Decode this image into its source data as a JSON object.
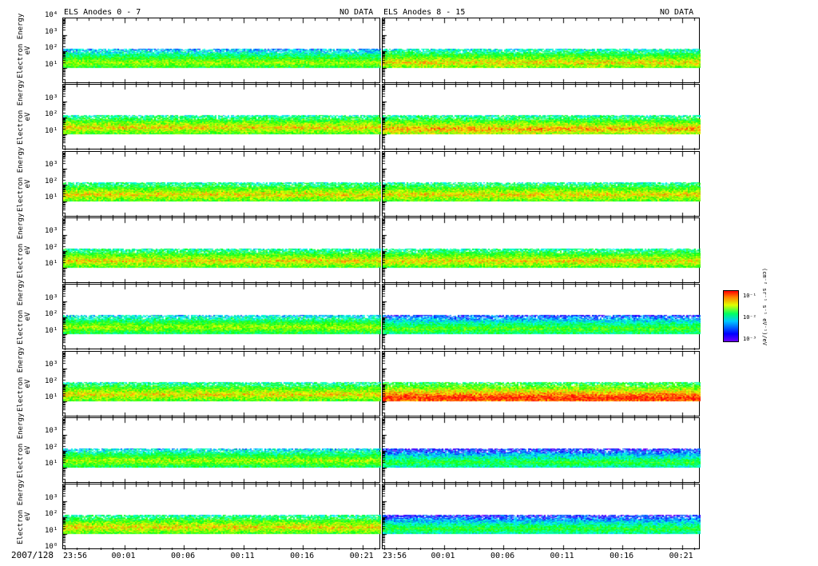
{
  "titles": {
    "left": "ELS Anodes 0 - 7",
    "right": "ELS Anodes 8 - 15",
    "left_status": "NO DATA",
    "right_status": "NO DATA"
  },
  "date_label": "2007/128",
  "colorbar": {
    "ticks": [
      "10⁻¹",
      "10⁻²",
      "10⁻³"
    ],
    "label": "(cm⁻² sr⁻¹ s⁻¹ eV⁻¹)/eV"
  },
  "chart_data": {
    "type": "heatmap",
    "ylabel": "Electron Energy",
    "yunit": "eV",
    "yscale": "log",
    "ylim": [
      1,
      10000
    ],
    "ytick_labels": [
      "10⁴",
      "10³",
      "10²",
      "10¹",
      "10⁰"
    ],
    "xtick_labels": [
      "23:56",
      "00:01",
      "00:06",
      "00:11",
      "00:16",
      "00:21"
    ],
    "xlim_minutes": [
      0,
      26.7
    ],
    "xtick_minutes": [
      0,
      5,
      10,
      15,
      20,
      25
    ],
    "columns": [
      "ELS Anodes 0 - 7",
      "ELS Anodes 8 - 15"
    ],
    "panels": [
      {
        "column": 0,
        "row": 0,
        "energy_range_eV": [
          10,
          140
        ],
        "peak_eV": 20,
        "peak_level": 0.7
      },
      {
        "column": 0,
        "row": 1,
        "energy_range_eV": [
          10,
          140
        ],
        "peak_eV": 25,
        "peak_level": 0.8
      },
      {
        "column": 0,
        "row": 2,
        "energy_range_eV": [
          10,
          140
        ],
        "peak_eV": 25,
        "peak_level": 0.8
      },
      {
        "column": 0,
        "row": 3,
        "energy_range_eV": [
          10,
          140
        ],
        "peak_eV": 25,
        "peak_level": 0.8
      },
      {
        "column": 0,
        "row": 4,
        "energy_range_eV": [
          10,
          140
        ],
        "peak_eV": 25,
        "peak_level": 0.7
      },
      {
        "column": 0,
        "row": 5,
        "energy_range_eV": [
          10,
          140
        ],
        "peak_eV": 25,
        "peak_level": 0.8
      },
      {
        "column": 0,
        "row": 6,
        "energy_range_eV": [
          10,
          140
        ],
        "peak_eV": 25,
        "peak_level": 0.7
      },
      {
        "column": 0,
        "row": 7,
        "energy_range_eV": [
          10,
          140
        ],
        "peak_eV": 25,
        "peak_level": 0.8
      },
      {
        "column": 1,
        "row": 0,
        "energy_range_eV": [
          10,
          140
        ],
        "peak_eV": 20,
        "peak_level": 0.8
      },
      {
        "column": 1,
        "row": 1,
        "energy_range_eV": [
          10,
          140
        ],
        "peak_eV": 20,
        "peak_level": 0.85
      },
      {
        "column": 1,
        "row": 2,
        "energy_range_eV": [
          10,
          140
        ],
        "peak_eV": 25,
        "peak_level": 0.8
      },
      {
        "column": 1,
        "row": 3,
        "energy_range_eV": [
          10,
          140
        ],
        "peak_eV": 25,
        "peak_level": 0.8
      },
      {
        "column": 1,
        "row": 4,
        "energy_range_eV": [
          10,
          140
        ],
        "peak_eV": 20,
        "peak_level": 0.6
      },
      {
        "column": 1,
        "row": 5,
        "energy_range_eV": [
          10,
          140
        ],
        "peak_eV": 15,
        "peak_level": 1.0
      },
      {
        "column": 1,
        "row": 6,
        "energy_range_eV": [
          10,
          140
        ],
        "peak_eV": 20,
        "peak_level": 0.55
      },
      {
        "column": 1,
        "row": 7,
        "energy_range_eV": [
          10,
          140
        ],
        "peak_eV": 20,
        "peak_level": 0.55
      }
    ]
  }
}
